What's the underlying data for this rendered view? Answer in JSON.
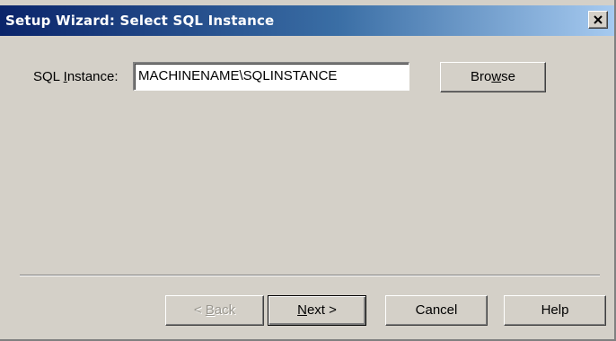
{
  "window": {
    "title": "Setup Wizard: Select SQL Instance",
    "close_icon": "close-x-icon"
  },
  "form": {
    "instance_label_pre": "SQL ",
    "instance_label_mnemonic": "I",
    "instance_label_post": "nstance:",
    "instance_value": "MACHINENAME\\SQLINSTANCE"
  },
  "buttons": {
    "browse": {
      "pre": "Bro",
      "mnemonic": "w",
      "post": "se"
    },
    "back": {
      "pre": "< ",
      "mnemonic": "B",
      "post": "ack",
      "enabled": false
    },
    "next": {
      "pre": "",
      "mnemonic": "N",
      "post": "ext >"
    },
    "cancel": "Cancel",
    "help": "Help"
  },
  "colors": {
    "face": "#d4d0c8",
    "title_start": "#0a246a",
    "title_end": "#a6caf0"
  }
}
